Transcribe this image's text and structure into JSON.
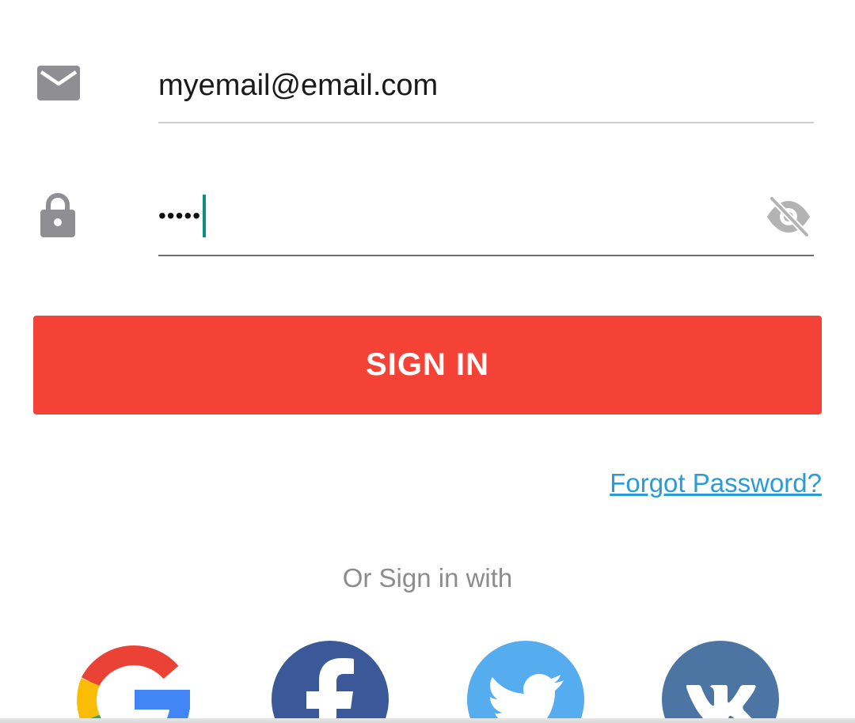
{
  "email": {
    "icon": "envelope-icon",
    "value": "myemail@email.com"
  },
  "password": {
    "icon": "lock-icon",
    "masked_value": "•••••",
    "visibility_icon": "eye-off-icon"
  },
  "sign_in": {
    "label": "SIGN IN",
    "color": "#f44336"
  },
  "forgot_password": {
    "label": "Forgot Password?",
    "color": "#2b9bd6"
  },
  "social": {
    "heading": "Or Sign in with",
    "providers": [
      {
        "name": "google-icon"
      },
      {
        "name": "facebook-icon",
        "color": "#3b5998"
      },
      {
        "name": "twitter-icon",
        "color": "#55acee"
      },
      {
        "name": "vk-icon",
        "color": "#4c75a3"
      }
    ]
  },
  "colors": {
    "caret": "#0d8f7f",
    "icon_gray": "#8e8e93"
  }
}
